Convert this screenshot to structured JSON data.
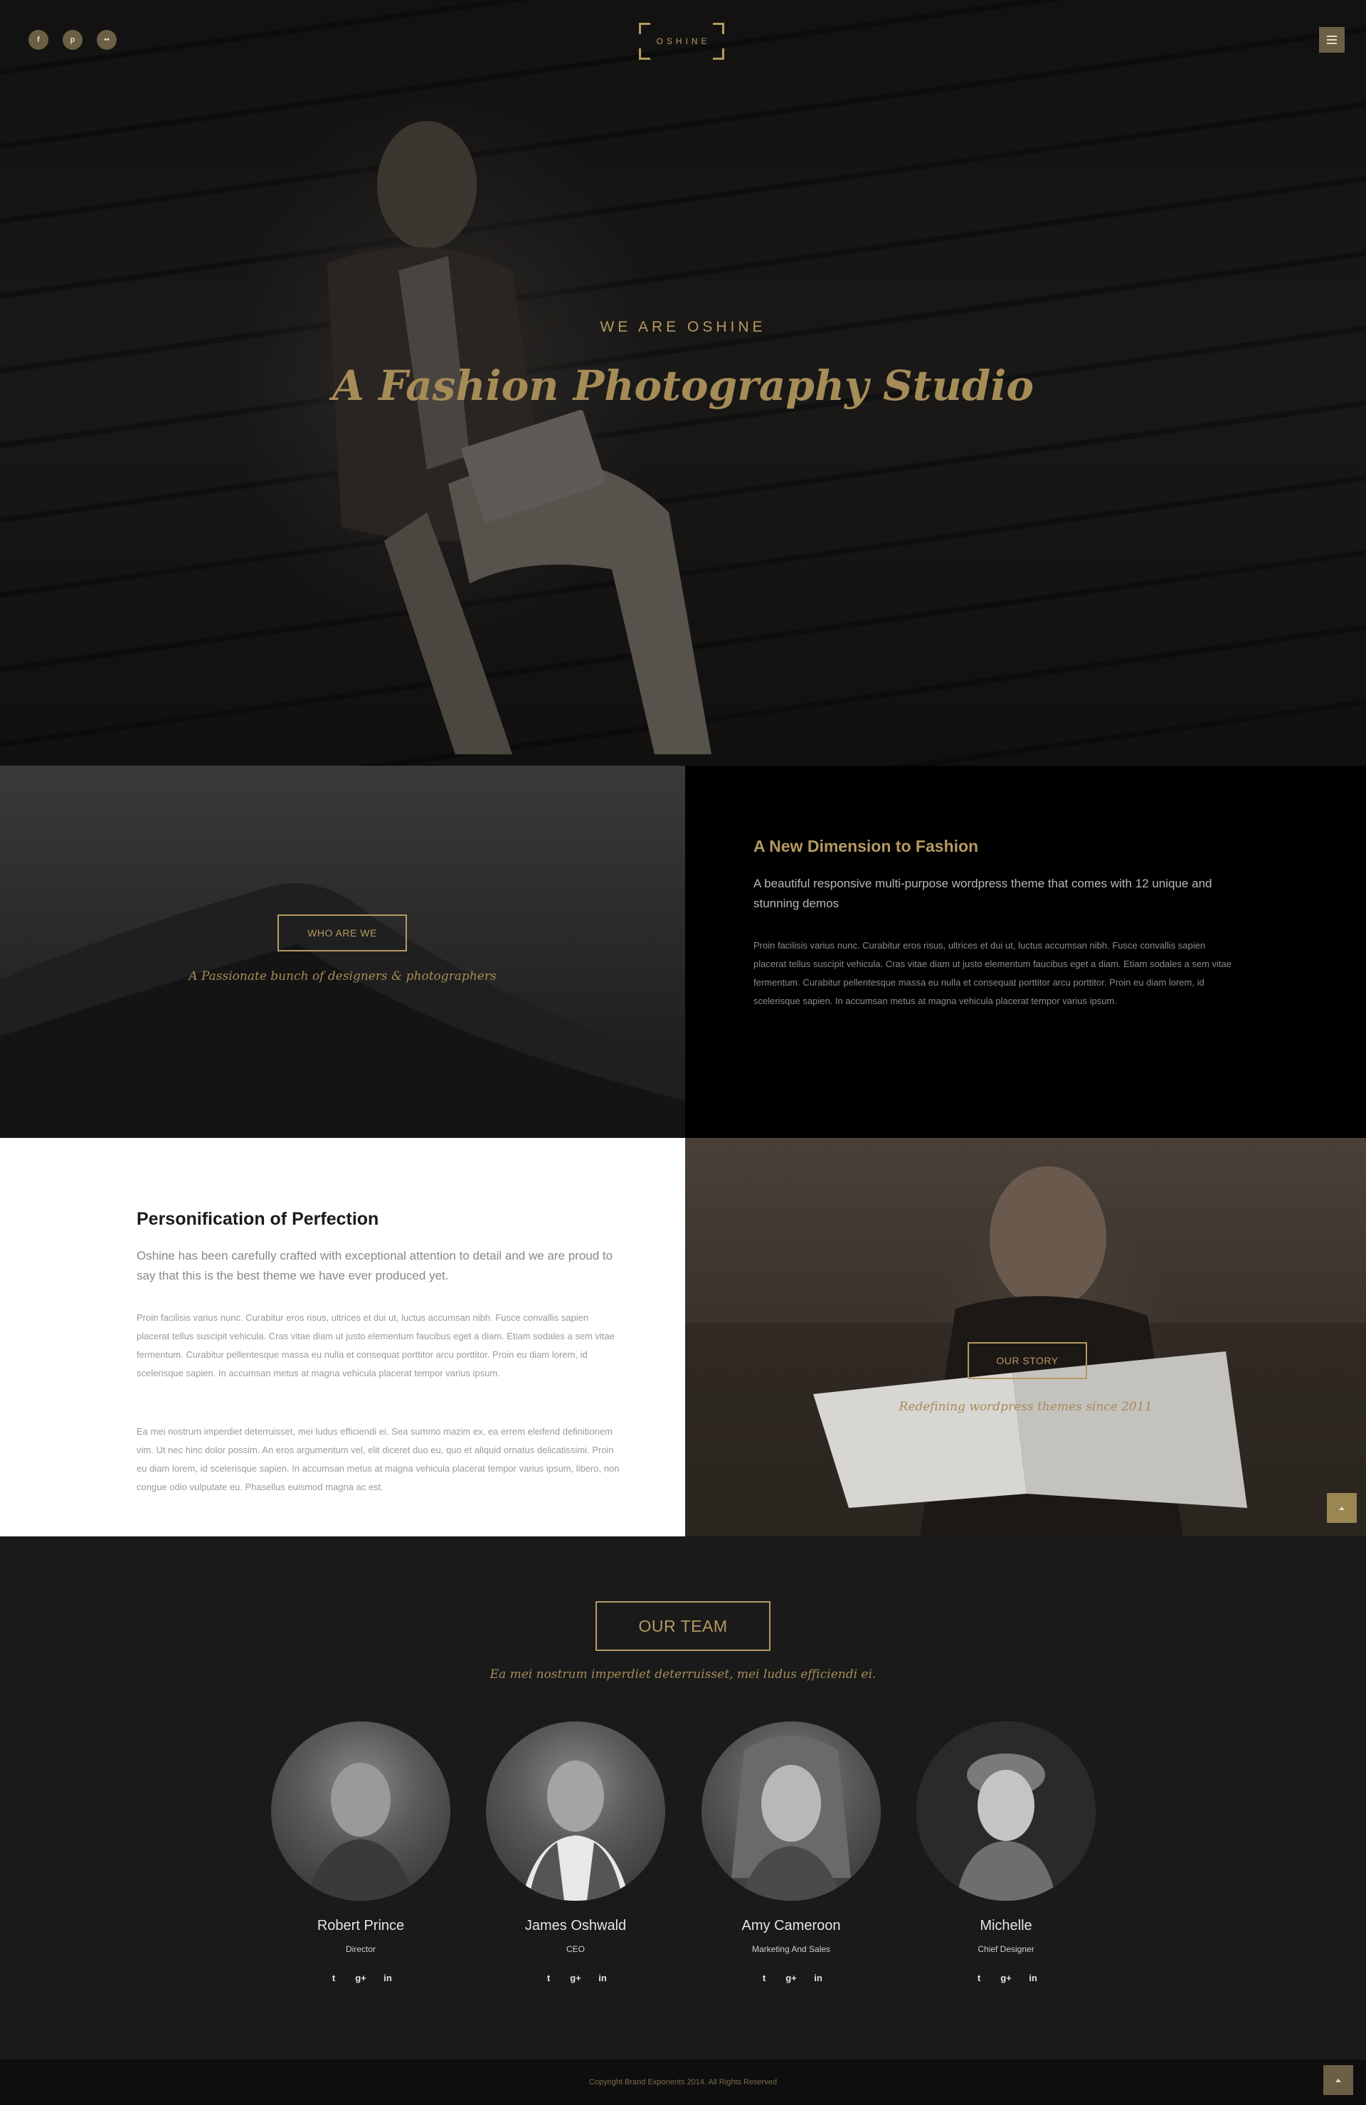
{
  "header": {
    "social": [
      {
        "icon": "facebook-icon",
        "glyph": "f"
      },
      {
        "icon": "pinterest-icon",
        "glyph": "p"
      },
      {
        "icon": "flickr-icon",
        "glyph": "••"
      }
    ],
    "logo_text": "OSHINE",
    "menu_icon": "hamburger-icon"
  },
  "hero": {
    "kicker": "WE ARE OSHINE",
    "title": "A Fashion Photography Studio"
  },
  "who": {
    "button": "WHO ARE WE",
    "tagline": "A Passionate bunch of designers & photographers"
  },
  "dimension": {
    "title": "A New Dimension to Fashion",
    "lead": "A beautiful responsive multi-purpose wordpress theme that comes with 12 unique and stunning demos",
    "body": "Proin facilisis varius nunc. Curabitur eros risus, ultrices et dui ut, luctus accumsan nibh. Fusce convallis sapien placerat tellus suscipit vehicula. Cras vitae diam ut justo elementum faucibus eget a diam. Etiam sodales a sem vitae fermentum. Curabitur pellentesque massa eu nulla et consequat porttitor arcu porttitor. Proin eu diam lorem, id scelerisque sapien. In accumsan metus at magna vehicula placerat tempor varius ipsum."
  },
  "perfection": {
    "title": "Personification of Perfection",
    "lead": "Oshine has been carefully crafted with exceptional attention to detail and we are proud to say that this is the best theme we have ever produced yet.",
    "body1": "Proin facilisis varius nunc. Curabitur eros risus, ultrices et dui ut, luctus accumsan nibh. Fusce convallis sapien placerat tellus suscipit vehicula. Cras vitae diam ut justo elementum faucibus eget a diam. Etiam sodales a sem vitae fermentum. Curabitur pellentesque massa eu nulla et consequat porttitor arcu porttitor. Proin eu diam lorem, id scelerisque sapien. In accumsan metus at magna vehicula placerat tempor varius ipsum.",
    "body2": "Ea mei nostrum imperdiet deterruisset, mei ludus efficiendi ei. Sea summo mazim ex, ea errem eleifend definitionem vim. Ut nec hinc dolor possim. An eros argumentum vel, elit diceret duo eu, quo et aliquid ornatus delicatissimi. Proin eu diam lorem, id scelerisque sapien. In accumsan metus at magna vehicula placerat tempor varius ipsum, libero, non congue odio vulputate eu. Phasellus euismod magna ac est."
  },
  "story": {
    "button": "OUR STORY",
    "tagline": "Redefining wordpress themes since 2011"
  },
  "team": {
    "button": "OUR TEAM",
    "tagline": "Ea mei nostrum imperdiet deterruisset, mei ludus efficiendi ei.",
    "members": [
      {
        "name": "Robert Prince",
        "role": "Director"
      },
      {
        "name": "James Oshwald",
        "role": "CEO"
      },
      {
        "name": "Amy Cameroon",
        "role": "Marketing And Sales"
      },
      {
        "name": "Michelle",
        "role": "Chief Designer"
      }
    ],
    "social_glyphs": {
      "twitter": "t",
      "gplus": "g+",
      "linkedin": "in"
    }
  },
  "footer": {
    "copyright": "Copyright Brand Exponents 2014. All Rights Reserved"
  },
  "colors": {
    "accent": "#b59a62",
    "accent_dark": "#6b6045",
    "hero_bg": "#161514",
    "team_bg": "#1a1a1a"
  }
}
